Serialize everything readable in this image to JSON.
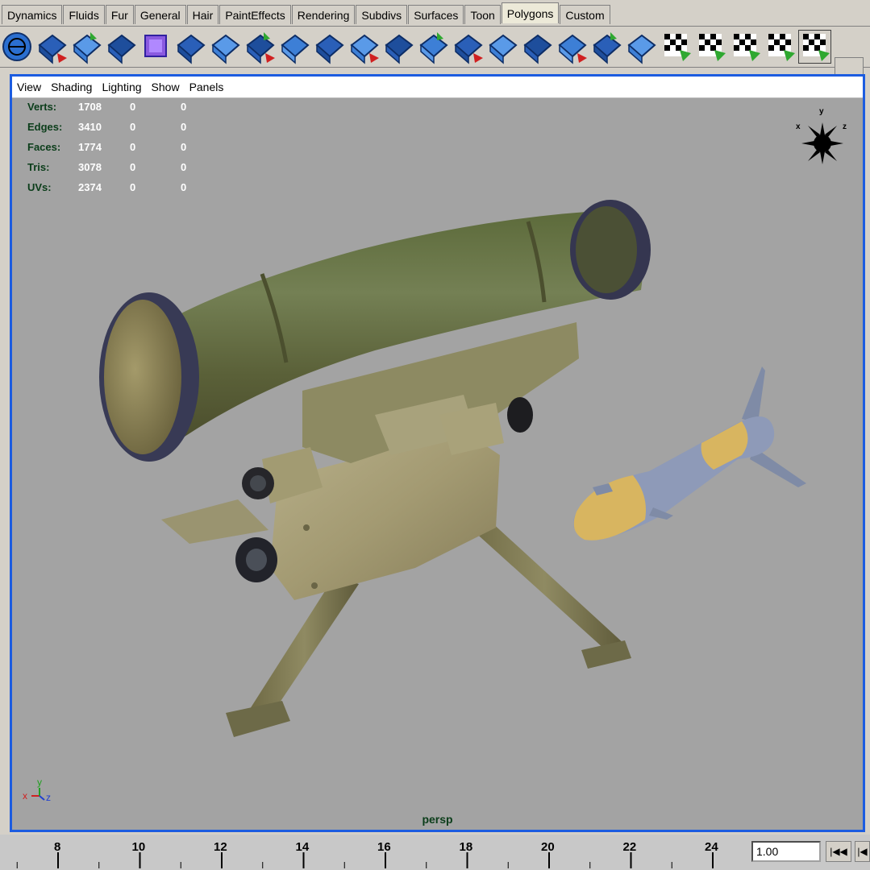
{
  "shelf": {
    "tabs": [
      "Dynamics",
      "Fluids",
      "Fur",
      "General",
      "Hair",
      "PaintEffects",
      "Rendering",
      "Subdivs",
      "Surfaces",
      "Toon",
      "Polygons",
      "Custom"
    ],
    "active_tab": "Polygons",
    "tools": [
      "polygon-sphere-icon",
      "extrude-face-icon",
      "combine-icon",
      "separate-icon",
      "cube-icon",
      "split-polygon-icon",
      "select-polygon-icon",
      "bevel-icon",
      "duplicate-face-icon",
      "extract-icon",
      "smooth-icon",
      "subdivide-icon",
      "triangulate-icon",
      "quadrangulate-icon",
      "merge-vertices-icon",
      "collapse-icon",
      "keep-faces-icon",
      "planar-mapping-icon",
      "cylindrical-mapping-icon",
      "spherical-mapping-icon",
      "automatic-mapping-icon",
      "checker-uv-icon",
      "layout-uv-icon",
      "uv-texture-editor-icon"
    ]
  },
  "viewport": {
    "menu": [
      "View",
      "Shading",
      "Lighting",
      "Show",
      "Panels"
    ],
    "hud": [
      {
        "label": "Verts:",
        "v1": "1708",
        "v2": "0",
        "v3": "0"
      },
      {
        "label": "Edges:",
        "v1": "3410",
        "v2": "0",
        "v3": "0"
      },
      {
        "label": "Faces:",
        "v1": "1774",
        "v2": "0",
        "v3": "0"
      },
      {
        "label": "Tris:",
        "v1": "3078",
        "v2": "0",
        "v3": "0"
      },
      {
        "label": "UVs:",
        "v1": "2374",
        "v2": "0",
        "v3": "0"
      }
    ],
    "camera": "persp",
    "view_cube": {
      "x": "x",
      "y": "y",
      "z": "z"
    },
    "axis": {
      "x": "x",
      "y": "y",
      "z": "z"
    },
    "colors": {
      "background": "#a3a3a3",
      "border": "#1c5ce0",
      "launcher": "#6b6b3e",
      "missile_body": "#8e9ab8",
      "missile_band": "#d8b560"
    }
  },
  "timeline": {
    "ticks": [
      "8",
      "10",
      "12",
      "14",
      "16",
      "18",
      "20",
      "22",
      "24"
    ],
    "current_frame": "1.00",
    "buttons": [
      "rewind-to-start",
      "step-back"
    ]
  }
}
